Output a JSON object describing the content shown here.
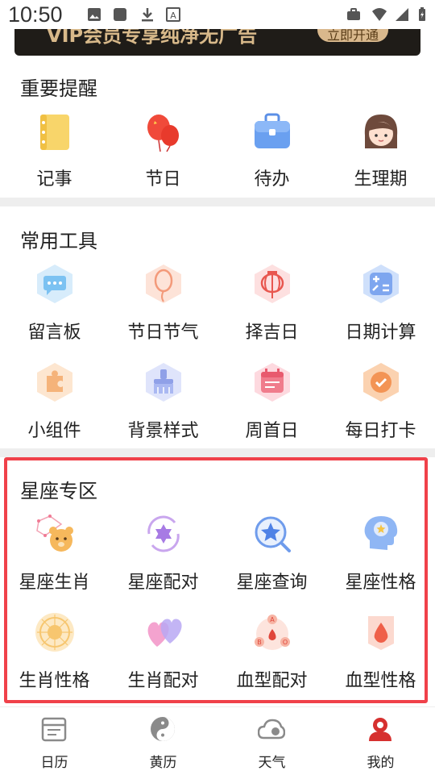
{
  "status_bar": {
    "time": "10:50"
  },
  "vip_banner": {
    "text": "VIP会员专享纯净无广告",
    "button": "立即开通"
  },
  "sections": [
    {
      "title": "重要提醒",
      "items": [
        {
          "label": "记事",
          "icon": "notebook-icon"
        },
        {
          "label": "节日",
          "icon": "balloons-icon"
        },
        {
          "label": "待办",
          "icon": "briefcase-icon"
        },
        {
          "label": "生理期",
          "icon": "girl-face-icon"
        }
      ]
    },
    {
      "title": "常用工具",
      "items": [
        {
          "label": "留言板",
          "icon": "message-icon"
        },
        {
          "label": "节日节气",
          "icon": "balloon-icon"
        },
        {
          "label": "择吉日",
          "icon": "lantern-icon"
        },
        {
          "label": "日期计算",
          "icon": "calculator-icon"
        },
        {
          "label": "小组件",
          "icon": "puzzle-icon"
        },
        {
          "label": "背景样式",
          "icon": "brush-icon"
        },
        {
          "label": "周首日",
          "icon": "calendar-icon"
        },
        {
          "label": "每日打卡",
          "icon": "check-icon"
        }
      ]
    },
    {
      "title": "星座专区",
      "items": [
        {
          "label": "星座生肖",
          "icon": "constellation-bear-icon"
        },
        {
          "label": "星座配对",
          "icon": "star-cycle-icon"
        },
        {
          "label": "星座查询",
          "icon": "star-search-icon"
        },
        {
          "label": "星座性格",
          "icon": "head-stars-icon"
        },
        {
          "label": "生肖性格",
          "icon": "zodiac-wheel-icon"
        },
        {
          "label": "生肖配对",
          "icon": "hearts-icon"
        },
        {
          "label": "血型配对",
          "icon": "blood-type-icon"
        },
        {
          "label": "血型性格",
          "icon": "blood-drop-icon"
        }
      ]
    }
  ],
  "bottom_nav": [
    {
      "label": "日历",
      "icon": "calendar-icon"
    },
    {
      "label": "黄历",
      "icon": "yin-yang-icon"
    },
    {
      "label": "天气",
      "icon": "weather-icon"
    },
    {
      "label": "我的",
      "icon": "user-icon"
    }
  ]
}
